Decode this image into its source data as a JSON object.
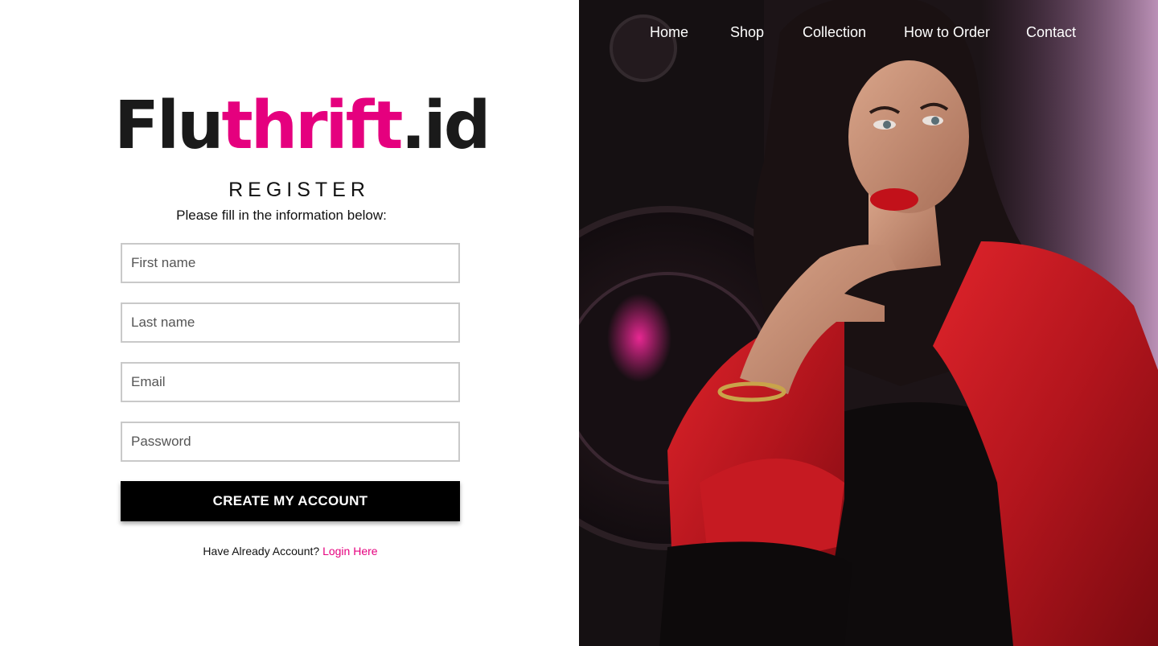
{
  "brand": {
    "logo_part1": "Flu",
    "logo_part2": "thrift",
    "logo_part3": ".id",
    "dark_color": "#1a1a1a",
    "accent_color": "#e5007e"
  },
  "form": {
    "title": "REGISTER",
    "subtitle": "Please fill in the information below:",
    "first_name_placeholder": "First name",
    "last_name_placeholder": "Last name",
    "email_placeholder": "Email",
    "password_placeholder": "Password",
    "submit_label": "CREATE MY ACCOUNT",
    "login_prompt": "Have Already Account? ",
    "login_link": "Login Here"
  },
  "nav": {
    "items": [
      "Home",
      "Shop",
      "Collection",
      "How to Order",
      "Contact"
    ]
  },
  "hero": {
    "image": "photo of a woman in a red jacket"
  }
}
